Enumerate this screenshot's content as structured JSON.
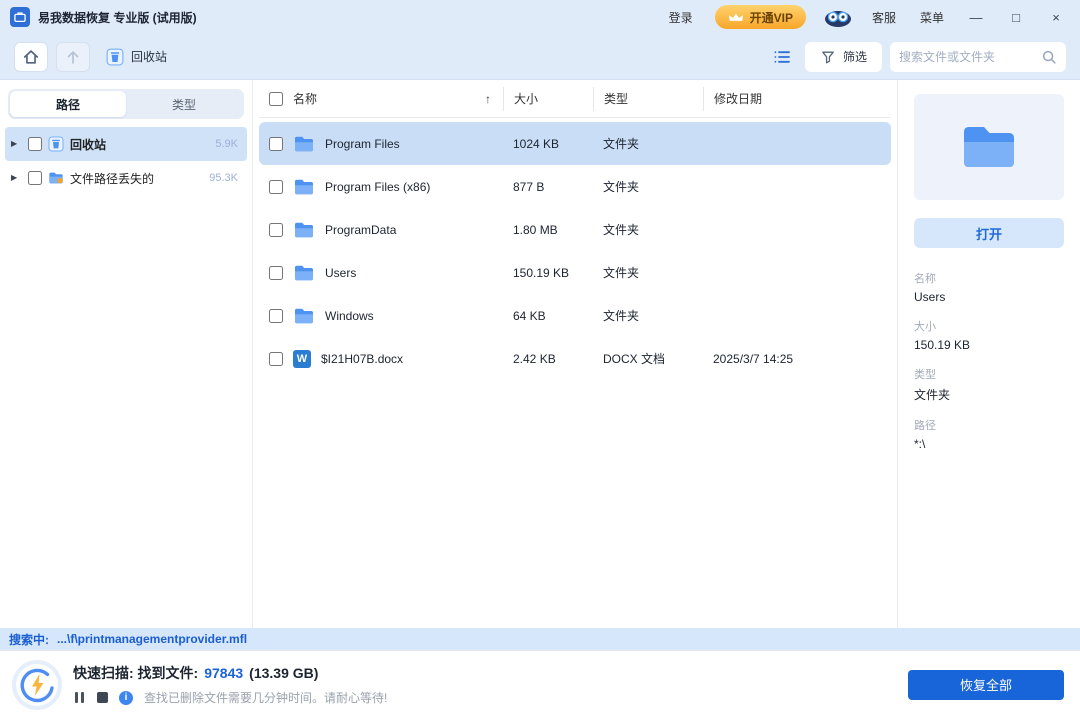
{
  "colors": {
    "accent_blue": "#1a66d8",
    "selection_blue": "#c9def6",
    "vip_orange": "#f7a62a",
    "titlebar_bg": "#e0ebfa",
    "status_strip_bg": "#d6e6fb"
  },
  "icons": {
    "sort_asc": "↑",
    "expander": "▶",
    "minimize": "—",
    "maximize": "□",
    "close": "×",
    "info": "i",
    "word": "W"
  },
  "titlebar": {
    "app_title": "易我数据恢复 专业版 (试用版)",
    "login": "登录",
    "vip_label": "开通VIP",
    "support": "客服",
    "menu": "菜单"
  },
  "toolbar": {
    "breadcrumb": "回收站",
    "filter_label": "筛选",
    "search_placeholder": "搜索文件或文件夹"
  },
  "sidebar": {
    "tabs": [
      {
        "label": "路径"
      },
      {
        "label": "类型"
      }
    ],
    "items": [
      {
        "label": "回收站",
        "count": "5.9K"
      },
      {
        "label": "文件路径丢失的",
        "count": "95.3K"
      }
    ]
  },
  "table": {
    "columns": [
      "名称",
      "大小",
      "类型",
      "修改日期"
    ],
    "rows": [
      {
        "name": "Program Files",
        "size": "1024 KB",
        "type": "文件夹",
        "date": ""
      },
      {
        "name": "Program Files (x86)",
        "size": "877 B",
        "type": "文件夹",
        "date": ""
      },
      {
        "name": "ProgramData",
        "size": "1.80 MB",
        "type": "文件夹",
        "date": ""
      },
      {
        "name": "Users",
        "size": "150.19 KB",
        "type": "文件夹",
        "date": ""
      },
      {
        "name": "Windows",
        "size": "64 KB",
        "type": "文件夹",
        "date": ""
      },
      {
        "name": "$I21H07B.docx",
        "size": "2.42 KB",
        "type": "DOCX 文档",
        "date": "2025/3/7 14:25"
      }
    ]
  },
  "details": {
    "open_label": "打开",
    "fields": [
      {
        "label": "名称",
        "value": "Users"
      },
      {
        "label": "大小",
        "value": "150.19 KB"
      },
      {
        "label": "类型",
        "value": "文件夹"
      },
      {
        "label": "路径",
        "value": "*:\\"
      }
    ]
  },
  "status": {
    "searching_label": "搜索中:",
    "searching_path": "...\\f\\printmanagementprovider.mfl"
  },
  "bottom": {
    "scan_label": "快速扫描: 找到文件:",
    "found_count": "97843",
    "found_size": "(13.39 GB)",
    "hint": "查找已删除文件需要几分钟时间。请耐心等待!",
    "recover_all": "恢复全部"
  }
}
